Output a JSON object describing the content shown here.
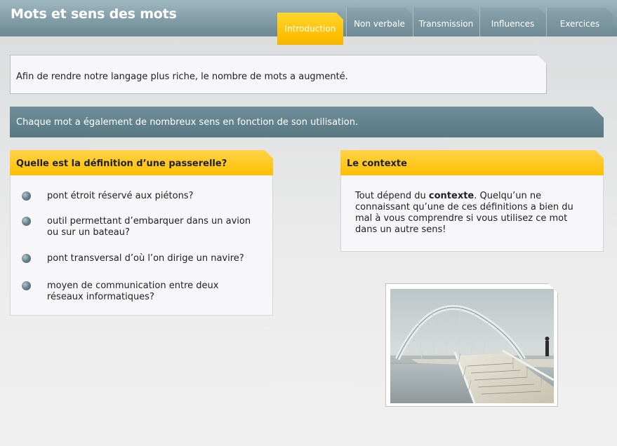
{
  "app": {
    "title": "Mots et sens des mots"
  },
  "tabs": [
    {
      "label": "Introduction",
      "active": true
    },
    {
      "label": "Non verbale",
      "active": false
    },
    {
      "label": "Transmission",
      "active": false
    },
    {
      "label": "Influences",
      "active": false
    },
    {
      "label": "Exercices",
      "active": false
    }
  ],
  "intro": {
    "text": "Afin de rendre notre langage plus riche, le nombre de mots a augmenté."
  },
  "banner": {
    "text": "Chaque mot a également de nombreux sens en fonction de son utilisation."
  },
  "question": {
    "title": "Quelle est la définition d’une passerelle?",
    "options": [
      "pont étroit réservé aux piétons?",
      "outil permettant d’embarquer dans un avion ou sur un bateau?",
      "pont transversal d’où l’on dirige un navire?",
      "moyen de communication entre deux réseaux informatiques?"
    ]
  },
  "context": {
    "title": "Le contexte",
    "text_before": "Tout dépend du ",
    "text_bold": "contexte",
    "text_after": ". Quelqu’un ne connaissant qu’une de ces définitions a bien du mal à vous comprendre si vous utilisez ce mot dans un autre sens!"
  },
  "colors": {
    "accent": "#ffc000",
    "header": "#7f9ba6",
    "banner": "#587883"
  }
}
